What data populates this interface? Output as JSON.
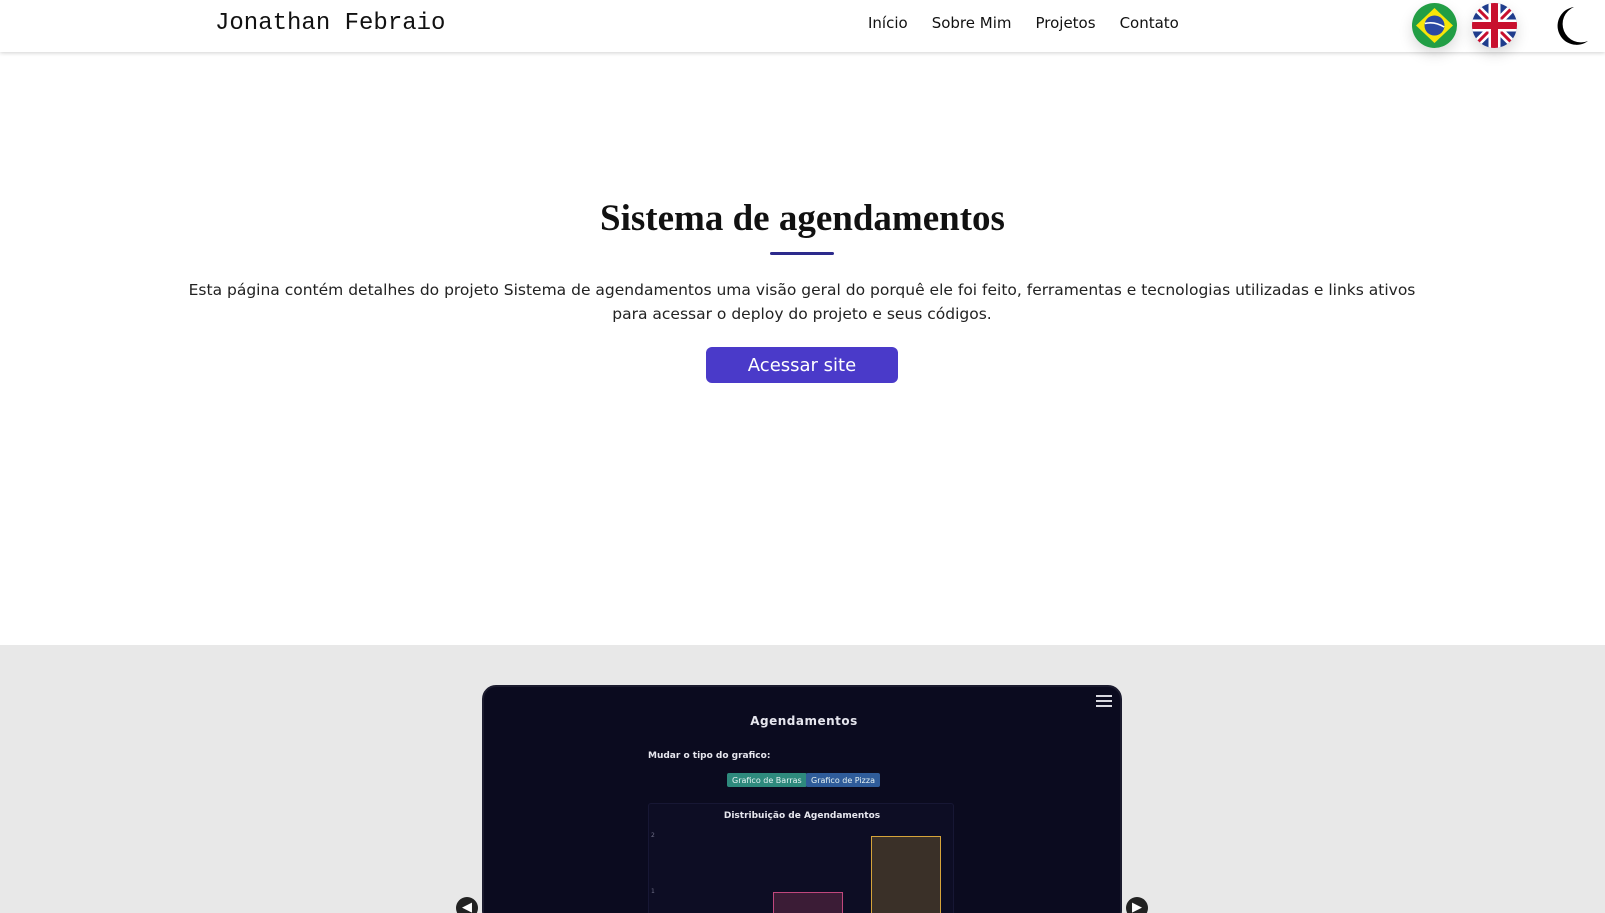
{
  "header": {
    "brand": "Jonathan Febraio",
    "nav": [
      "Início",
      "Sobre Mim",
      "Projetos",
      "Contato"
    ],
    "language_flags": [
      "brazil-flag-icon",
      "uk-flag-icon"
    ],
    "theme_icon": "moon-icon"
  },
  "hero": {
    "title": "Sistema de agendamentos",
    "description": "Esta página contém detalhes do projeto Sistema de agendamentos uma visão geral do porquê ele foi feito, ferramentas e tecnologias utilizadas e links ativos para acessar o deploy do projeto e seus códigos.",
    "cta_label": "Acessar site",
    "accent_color": "#4a3ac9"
  },
  "gallery": {
    "prev_icon": "chevron-left-icon",
    "next_icon": "chevron-right-icon",
    "screenshot": {
      "title": "Agendamentos",
      "chart_type_label": "Mudar o tipo do grafico:",
      "buttons": [
        "Grafico de Barras",
        "Grafico de Pizza"
      ],
      "chart_title": "Distribuição de Agendamentos",
      "y_ticks": [
        "2",
        "1"
      ],
      "bar_values": [
        1,
        2
      ]
    }
  }
}
